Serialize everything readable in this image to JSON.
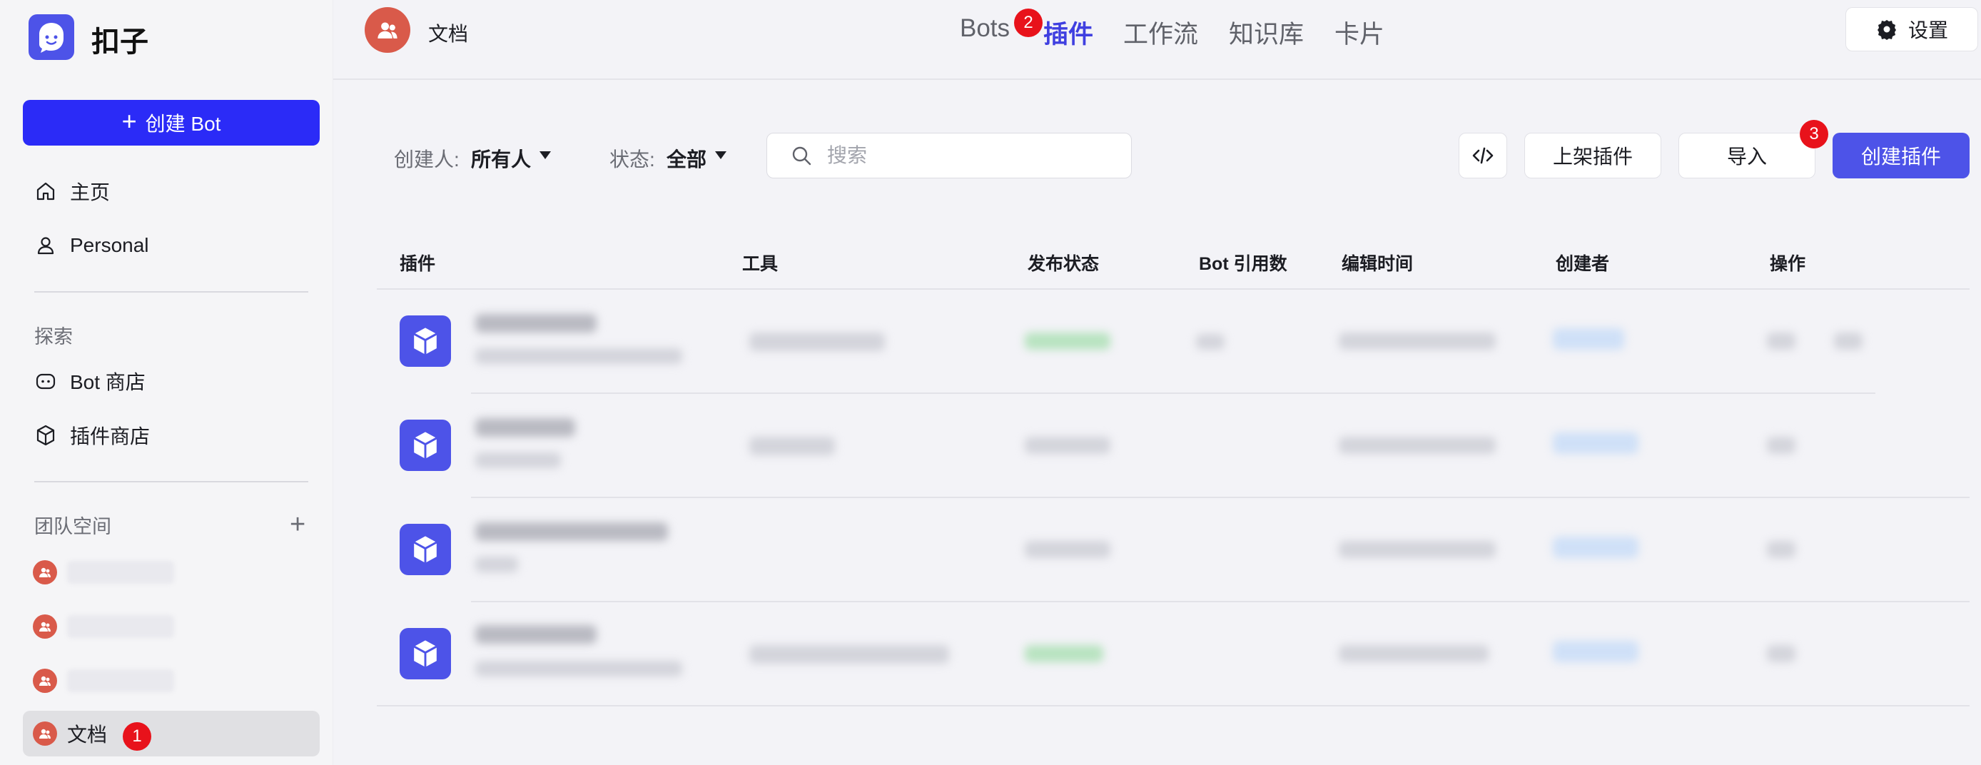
{
  "app": {
    "name": "扣子"
  },
  "sidebar": {
    "create_bot_label": "创建 Bot",
    "nav": [
      {
        "label": "主页",
        "icon": "home-icon"
      },
      {
        "label": "Personal",
        "icon": "user-icon"
      }
    ],
    "explore_label": "探索",
    "explore_items": [
      {
        "label": "Bot 商店",
        "icon": "bot-icon"
      },
      {
        "label": "插件商店",
        "icon": "cube-icon"
      }
    ],
    "team_label": "团队空间",
    "team_spaces": [
      {
        "label": ""
      },
      {
        "label": ""
      },
      {
        "label": ""
      },
      {
        "label": "文档",
        "active": true
      }
    ]
  },
  "header": {
    "workspace_title": "文档",
    "tabs": [
      {
        "label": "Bots"
      },
      {
        "label": "插件",
        "active": true
      },
      {
        "label": "工作流"
      },
      {
        "label": "知识库"
      },
      {
        "label": "卡片"
      }
    ],
    "settings_label": "设置"
  },
  "toolbar": {
    "creator_label": "创建人:",
    "creator_value": "所有人",
    "status_label": "状态:",
    "status_value": "全部",
    "search_placeholder": "搜索",
    "publish_label": "上架插件",
    "import_label": "导入",
    "create_label": "创建插件"
  },
  "table": {
    "columns": [
      "插件",
      "工具",
      "发布状态",
      "Bot 引用数",
      "编辑时间",
      "创建者",
      "操作"
    ],
    "row_count": 4
  },
  "annotations": [
    "1",
    "2",
    "3"
  ],
  "colors": {
    "primary": "#4d53e8",
    "create_bot": "#2b2bf7",
    "badge": "#e8121b",
    "space_avatar": "#d95a4a"
  }
}
